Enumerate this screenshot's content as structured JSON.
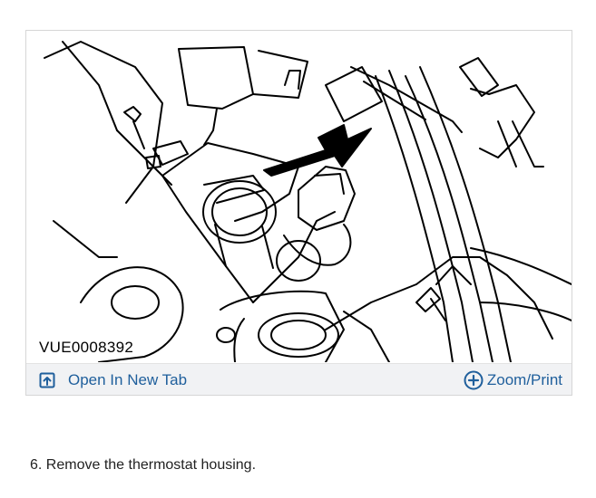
{
  "figure": {
    "id_label": "VUE0008392"
  },
  "actions": {
    "open_new_tab": {
      "label": "Open In New Tab",
      "icon": "open-in-new-tab-icon"
    },
    "zoom_print": {
      "label": "Zoom/Print",
      "icon": "plus-circle-icon"
    }
  },
  "colors": {
    "link": "#1f5f9c",
    "action_bar_bg": "#f1f2f4",
    "card_border": "#d6d6d6"
  },
  "steps": [
    {
      "text": "6. Remove the thermostat housing."
    }
  ]
}
